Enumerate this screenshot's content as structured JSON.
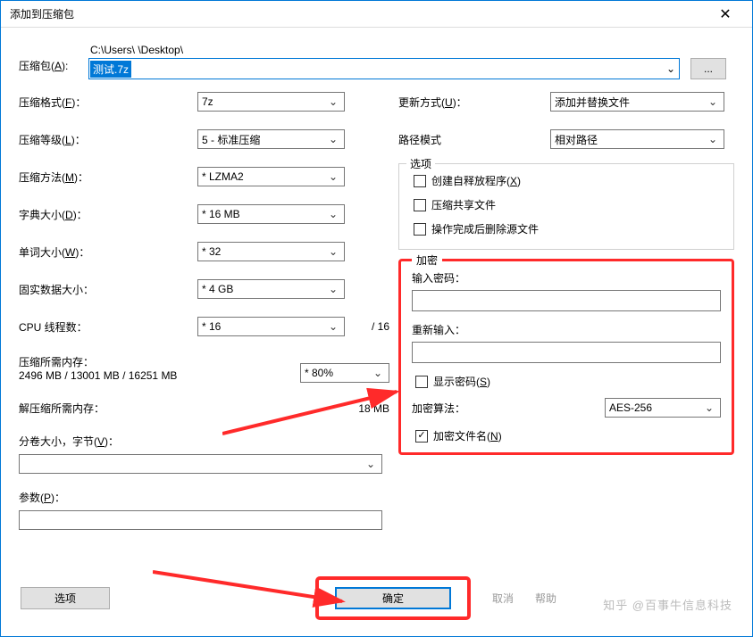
{
  "window": {
    "title": "添加到压缩包"
  },
  "archive": {
    "label": "压缩包",
    "accel": "A",
    "path_text": "C:\\Users\\             \\Desktop\\",
    "combo_value": "测试.7z",
    "browse": "..."
  },
  "left": {
    "format": {
      "label": "压缩格式",
      "accel": "F",
      "value": "7z"
    },
    "level": {
      "label": "压缩等级",
      "accel": "L",
      "value": "5 - 标准压缩"
    },
    "method": {
      "label": "压缩方法",
      "accel": "M",
      "value": "* LZMA2"
    },
    "dict": {
      "label": "字典大小",
      "accel": "D",
      "value": "* 16 MB"
    },
    "word": {
      "label": "单词大小",
      "accel": "W",
      "value": "* 32"
    },
    "solid": {
      "label": "固实数据大小",
      "value": "* 4 GB"
    },
    "threads": {
      "label": "CPU 线程数",
      "value": "* 16",
      "total": "/ 16"
    },
    "mem_comp": {
      "label": "压缩所需内存",
      "value_line": "2496 MB / 13001 MB / 16251 MB",
      "pct": "* 80%"
    },
    "mem_decomp": {
      "label": "解压缩所需内存",
      "value": "18 MB"
    },
    "split": {
      "label": "分卷大小，字节",
      "accel": "V"
    },
    "params": {
      "label": "参数",
      "accel": "P"
    },
    "options_btn": "选项"
  },
  "right": {
    "update": {
      "label": "更新方式",
      "accel": "U",
      "value": "添加并替换文件"
    },
    "pathmode": {
      "label": "路径模式",
      "value": "相对路径"
    },
    "options_legend": "选项",
    "sfx": {
      "label": "创建自释放程序",
      "accel": "X"
    },
    "shared": "压缩共享文件",
    "delete_after": "操作完成后删除源文件"
  },
  "encrypt": {
    "legend": "加密",
    "pwd": "输入密码：",
    "pwd2": "重新输入：",
    "show": {
      "label": "显示密码",
      "accel": "S"
    },
    "alg_label": "加密算法",
    "alg_value": "AES-256",
    "enc_names": {
      "label": "加密文件名",
      "accel": "N"
    }
  },
  "buttons": {
    "ok": "确定",
    "cancel": "取消",
    "help": "帮助"
  },
  "watermark": "知乎 @百事牛信息科技"
}
